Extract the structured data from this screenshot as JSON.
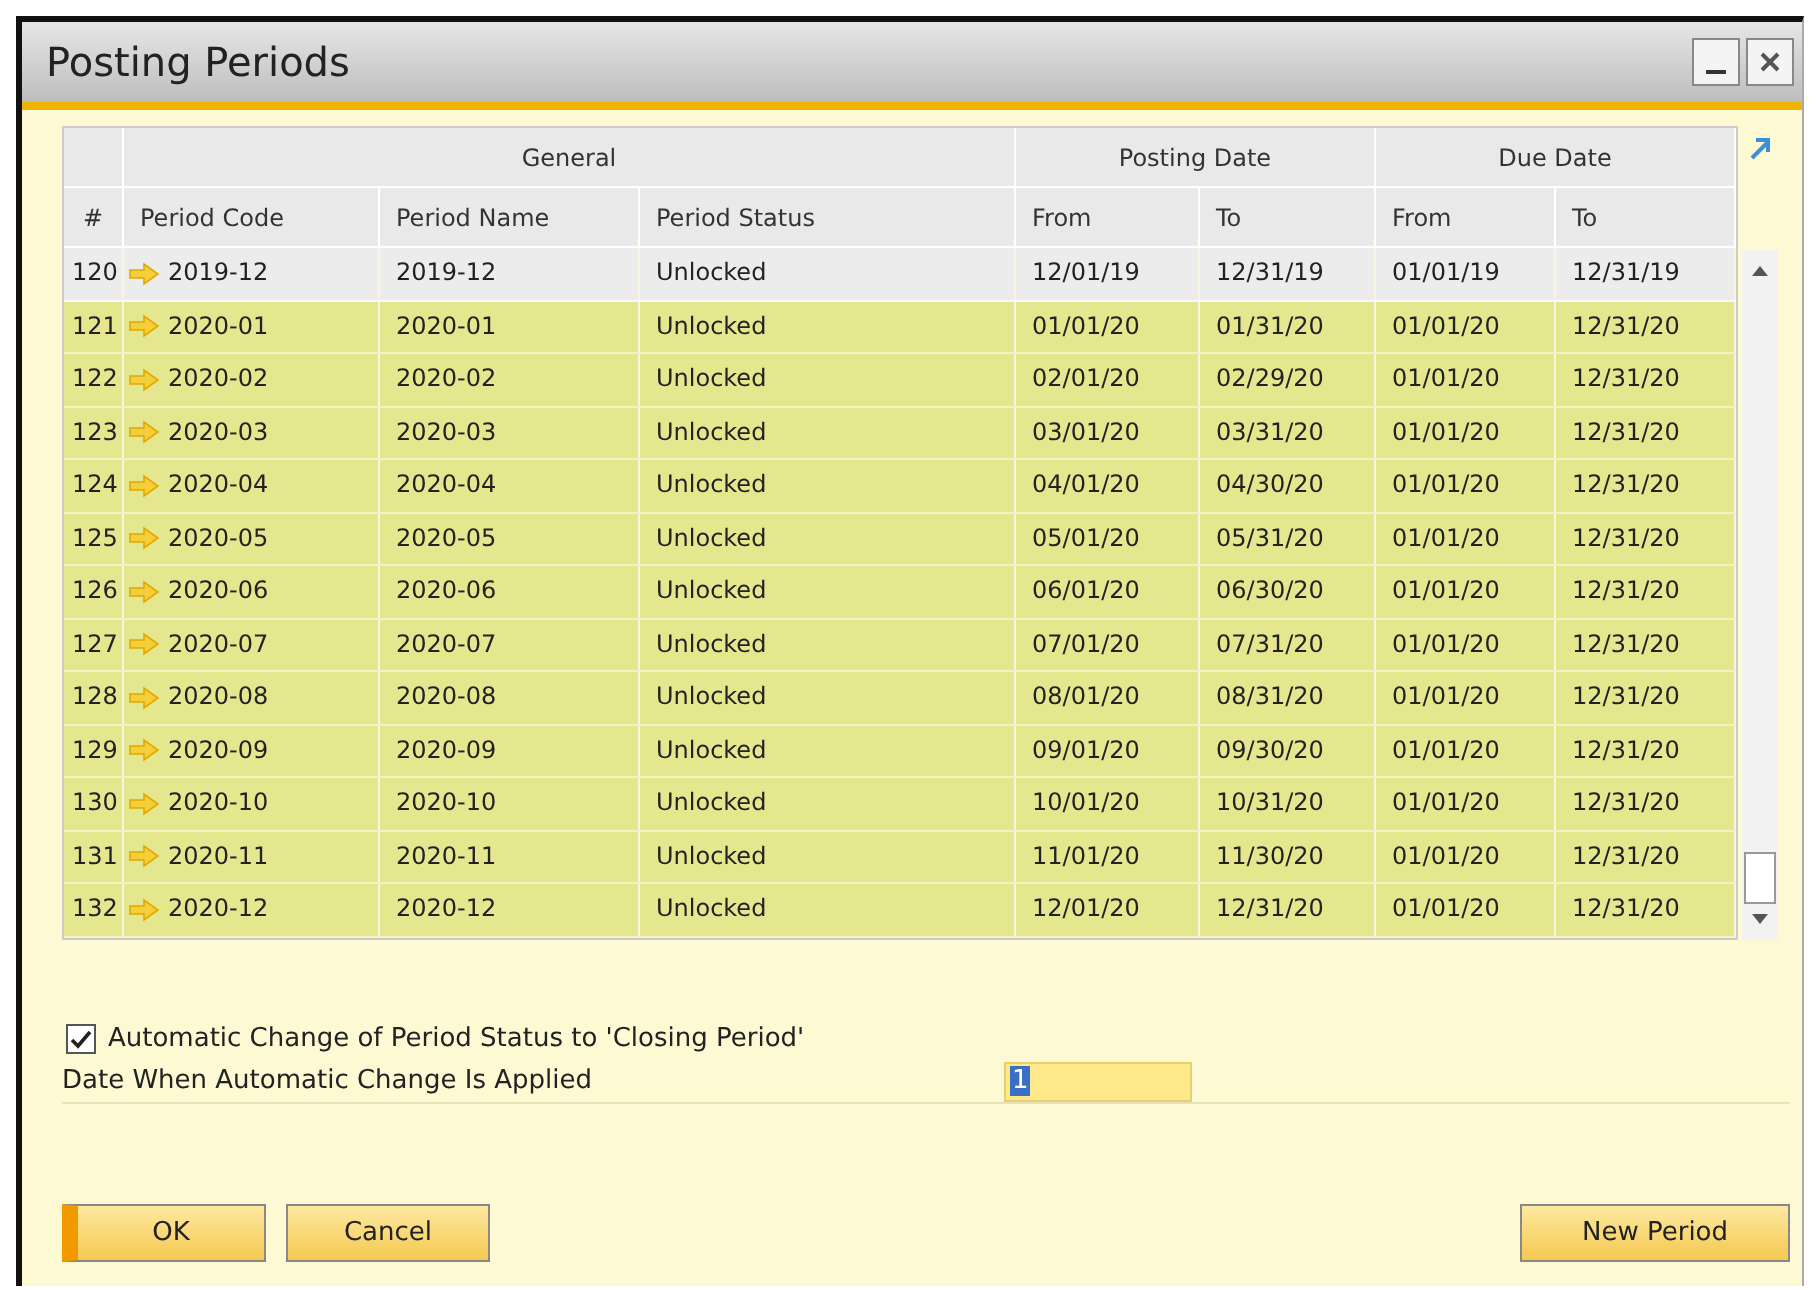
{
  "window": {
    "title": "Posting Periods"
  },
  "table": {
    "groups": [
      "General",
      "Posting Date",
      "Due Date"
    ],
    "columns": [
      "#",
      "Period Code",
      "Period Name",
      "Period Status",
      "From",
      "To",
      "From",
      "To"
    ],
    "rows": [
      {
        "num": "120",
        "code": "2019-12",
        "name": "2019-12",
        "status": "Unlocked",
        "post_from": "12/01/19",
        "post_to": "12/31/19",
        "due_from": "01/01/19",
        "due_to": "12/31/19",
        "selected": false
      },
      {
        "num": "121",
        "code": "2020-01",
        "name": "2020-01",
        "status": "Unlocked",
        "post_from": "01/01/20",
        "post_to": "01/31/20",
        "due_from": "01/01/20",
        "due_to": "12/31/20",
        "selected": true
      },
      {
        "num": "122",
        "code": "2020-02",
        "name": "2020-02",
        "status": "Unlocked",
        "post_from": "02/01/20",
        "post_to": "02/29/20",
        "due_from": "01/01/20",
        "due_to": "12/31/20",
        "selected": true
      },
      {
        "num": "123",
        "code": "2020-03",
        "name": "2020-03",
        "status": "Unlocked",
        "post_from": "03/01/20",
        "post_to": "03/31/20",
        "due_from": "01/01/20",
        "due_to": "12/31/20",
        "selected": true
      },
      {
        "num": "124",
        "code": "2020-04",
        "name": "2020-04",
        "status": "Unlocked",
        "post_from": "04/01/20",
        "post_to": "04/30/20",
        "due_from": "01/01/20",
        "due_to": "12/31/20",
        "selected": true
      },
      {
        "num": "125",
        "code": "2020-05",
        "name": "2020-05",
        "status": "Unlocked",
        "post_from": "05/01/20",
        "post_to": "05/31/20",
        "due_from": "01/01/20",
        "due_to": "12/31/20",
        "selected": true
      },
      {
        "num": "126",
        "code": "2020-06",
        "name": "2020-06",
        "status": "Unlocked",
        "post_from": "06/01/20",
        "post_to": "06/30/20",
        "due_from": "01/01/20",
        "due_to": "12/31/20",
        "selected": true
      },
      {
        "num": "127",
        "code": "2020-07",
        "name": "2020-07",
        "status": "Unlocked",
        "post_from": "07/01/20",
        "post_to": "07/31/20",
        "due_from": "01/01/20",
        "due_to": "12/31/20",
        "selected": true
      },
      {
        "num": "128",
        "code": "2020-08",
        "name": "2020-08",
        "status": "Unlocked",
        "post_from": "08/01/20",
        "post_to": "08/31/20",
        "due_from": "01/01/20",
        "due_to": "12/31/20",
        "selected": true
      },
      {
        "num": "129",
        "code": "2020-09",
        "name": "2020-09",
        "status": "Unlocked",
        "post_from": "09/01/20",
        "post_to": "09/30/20",
        "due_from": "01/01/20",
        "due_to": "12/31/20",
        "selected": true
      },
      {
        "num": "130",
        "code": "2020-10",
        "name": "2020-10",
        "status": "Unlocked",
        "post_from": "10/01/20",
        "post_to": "10/31/20",
        "due_from": "01/01/20",
        "due_to": "12/31/20",
        "selected": true
      },
      {
        "num": "131",
        "code": "2020-11",
        "name": "2020-11",
        "status": "Unlocked",
        "post_from": "11/01/20",
        "post_to": "11/30/20",
        "due_from": "01/01/20",
        "due_to": "12/31/20",
        "selected": true
      },
      {
        "num": "132",
        "code": "2020-12",
        "name": "2020-12",
        "status": "Unlocked",
        "post_from": "12/01/20",
        "post_to": "12/31/20",
        "due_from": "01/01/20",
        "due_to": "12/31/20",
        "selected": true
      }
    ]
  },
  "auto_change": {
    "label": "Automatic Change of Period Status to 'Closing Period'",
    "checked": true
  },
  "date_field": {
    "label": "Date When Automatic Change Is Applied",
    "value": "1"
  },
  "buttons": [
    {
      "label": "OK",
      "kind": "default"
    },
    {
      "label": "Cancel",
      "kind": "normal"
    },
    {
      "label": "New Period",
      "kind": "right"
    }
  ]
}
